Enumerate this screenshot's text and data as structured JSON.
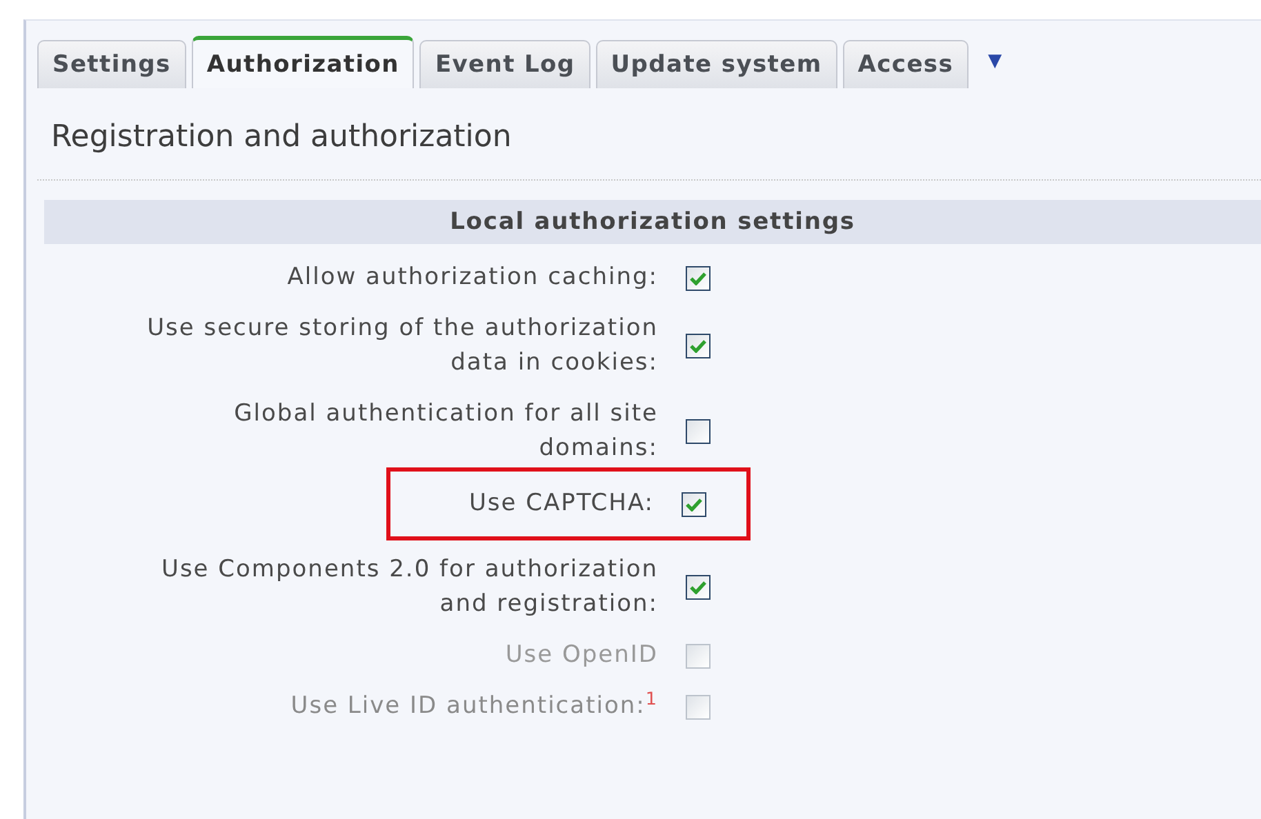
{
  "tabs": [
    {
      "label": "Settings",
      "selected": false
    },
    {
      "label": "Authorization",
      "selected": true
    },
    {
      "label": "Event Log",
      "selected": false
    },
    {
      "label": "Update system",
      "selected": false
    },
    {
      "label": "Access",
      "selected": false
    }
  ],
  "more_tabs": "▼",
  "heading": "Registration and authorization",
  "section": {
    "title": "Local authorization settings",
    "rows": [
      {
        "label": "Allow authorization caching:",
        "checked": true,
        "disabled": false,
        "highlighted": false
      },
      {
        "label": "Use secure storing of the authorization data in cookies:",
        "checked": true,
        "disabled": false,
        "highlighted": false
      },
      {
        "label": "Global authentication for all site domains:",
        "checked": false,
        "disabled": false,
        "highlighted": false
      },
      {
        "label": "Use CAPTCHA:",
        "checked": true,
        "disabled": false,
        "highlighted": true
      },
      {
        "label": "Use Components 2.0 for authorization and registration:",
        "checked": true,
        "disabled": false,
        "highlighted": false
      },
      {
        "label": "Use OpenID",
        "checked": false,
        "disabled": true,
        "highlighted": false
      },
      {
        "label": "Use Live ID authentication:$^{1}$",
        "checked": false,
        "disabled": true,
        "highlighted": false
      }
    ]
  }
}
